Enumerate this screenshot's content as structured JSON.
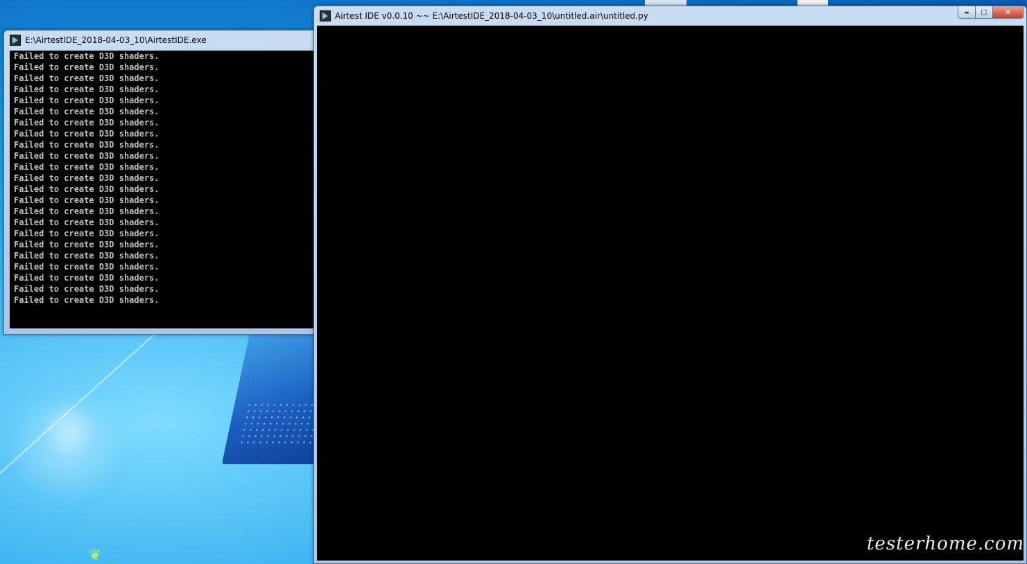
{
  "console_window": {
    "title": "E:\\AirtestIDE_2018-04-03_10\\AirtestIDE.exe",
    "icon": "airtest-app-icon",
    "lines": [
      "Failed to create D3D shaders.",
      "Failed to create D3D shaders.",
      "Failed to create D3D shaders.",
      "Failed to create D3D shaders.",
      "Failed to create D3D shaders.",
      "Failed to create D3D shaders.",
      "Failed to create D3D shaders.",
      "Failed to create D3D shaders.",
      "Failed to create D3D shaders.",
      "Failed to create D3D shaders.",
      "Failed to create D3D shaders.",
      "Failed to create D3D shaders.",
      "Failed to create D3D shaders.",
      "Failed to create D3D shaders.",
      "Failed to create D3D shaders.",
      "Failed to create D3D shaders.",
      "Failed to create D3D shaders.",
      "Failed to create D3D shaders.",
      "Failed to create D3D shaders.",
      "Failed to create D3D shaders.",
      "Failed to create D3D shaders.",
      "Failed to create D3D shaders.",
      "Failed to create D3D shaders."
    ]
  },
  "ide_window": {
    "title": "Airtest IDE v0.0.10 ~~ E:\\AirtestIDE_2018-04-03_10\\untitled.air\\untitled.py",
    "icon": "airtest-app-icon",
    "minimize_glyph": "▬",
    "maximize_glyph": "◻",
    "close_glyph": "✕"
  },
  "watermark": "testerhome.com",
  "colors": {
    "console_bg": "#000000",
    "console_text": "#c0c0c0",
    "desktop_blue": "#1a8ee0"
  }
}
